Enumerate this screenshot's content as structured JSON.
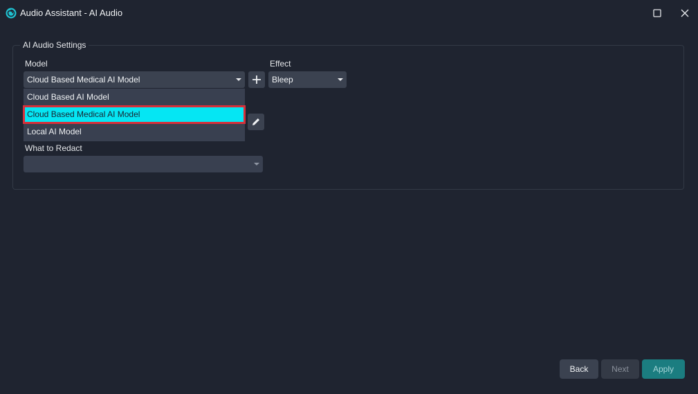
{
  "window": {
    "title": "Audio Assistant - AI Audio",
    "icons": [
      "app-logo-icon",
      "maximize-icon",
      "close-icon"
    ]
  },
  "settings": {
    "group_title": "AI Audio Settings",
    "model_label": "Model",
    "model_value": "Cloud Based Medical AI Model",
    "effect_label": "Effect",
    "effect_value": "Bleep",
    "redact_label": "What to Redact",
    "redact_value": "",
    "model_options": [
      {
        "label": "Cloud Based AI Model",
        "selected": false
      },
      {
        "label": "Cloud Based Medical AI Model",
        "selected": true
      },
      {
        "label": "Local AI Model",
        "selected": false
      }
    ]
  },
  "footer": {
    "back_label": "Back",
    "next_label": "Next",
    "apply_label": "Apply"
  },
  "colors": {
    "background": "#1f2430",
    "control": "#3b4250",
    "highlight": "#05e6f3",
    "highlight_border": "#d6303a",
    "apply": "#1b7d80",
    "accent": "#1fc3d2"
  }
}
